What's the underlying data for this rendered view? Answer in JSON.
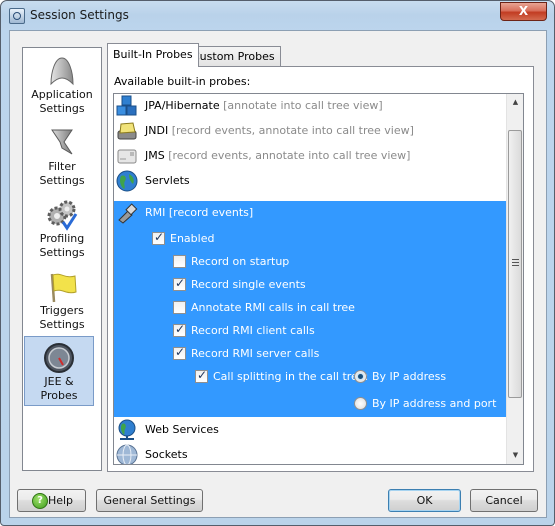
{
  "window": {
    "title": "Session Settings",
    "close_label": "X"
  },
  "sidebar": {
    "items": [
      {
        "label_line1": "Application",
        "label_line2": "Settings",
        "icon": "application-icon",
        "selected": false
      },
      {
        "label_line1": "Filter",
        "label_line2": "Settings",
        "icon": "filter-funnel-icon",
        "selected": false
      },
      {
        "label_line1": "Profiling",
        "label_line2": "Settings",
        "icon": "gears-icon",
        "selected": false
      },
      {
        "label_line1": "Triggers",
        "label_line2": "Settings",
        "icon": "flag-icon",
        "selected": false
      },
      {
        "label_line1": "JEE &",
        "label_line2": "Probes",
        "icon": "gauge-icon",
        "selected": true
      }
    ]
  },
  "tabs": [
    {
      "label": "Built-In Probes",
      "active": true
    },
    {
      "label": "Custom Probes",
      "active": false
    }
  ],
  "panel": {
    "label": "Available built-in probes:",
    "probes": [
      {
        "name": "JPA/Hibernate",
        "desc": "[annotate into call tree view]",
        "icon": "blocks-icon"
      },
      {
        "name": "JNDI",
        "desc": "[record events, annotate into call tree view]",
        "icon": "directory-icon"
      },
      {
        "name": "JMS",
        "desc": "[record events, annotate into call tree view]",
        "icon": "mail-icon"
      },
      {
        "name": "Servlets",
        "desc": "",
        "icon": "globe-icon"
      },
      {
        "name": "RMI",
        "desc": "[record events]",
        "icon": "network-plug-icon",
        "selected": true
      },
      {
        "name": "Web Services",
        "desc": "",
        "icon": "network-globe-icon"
      },
      {
        "name": "Sockets",
        "desc": "",
        "icon": "sphere-icon"
      }
    ],
    "rmi_options": {
      "enabled": {
        "label": "Enabled",
        "checked": true
      },
      "record_on_startup": {
        "label": "Record on startup",
        "checked": false
      },
      "record_single_events": {
        "label": "Record single events",
        "checked": true
      },
      "annotate_rmi_calls": {
        "label": "Annotate RMI calls in call tree",
        "checked": false
      },
      "record_client_calls": {
        "label": "Record RMI client calls",
        "checked": true
      },
      "record_server_calls": {
        "label": "Record RMI server calls",
        "checked": true
      },
      "call_splitting": {
        "label": "Call splitting in the call tree:",
        "checked": true
      },
      "split_by_ip": {
        "label": "By IP address",
        "selected": true
      },
      "split_by_ip_port": {
        "label": "By IP address and port",
        "selected": false
      }
    }
  },
  "buttons": {
    "help": "Help",
    "general_settings": "General Settings",
    "ok": "OK",
    "cancel": "Cancel"
  },
  "colors": {
    "selection": "#3399ff",
    "sidebar_selected": "#c5d9f1"
  }
}
